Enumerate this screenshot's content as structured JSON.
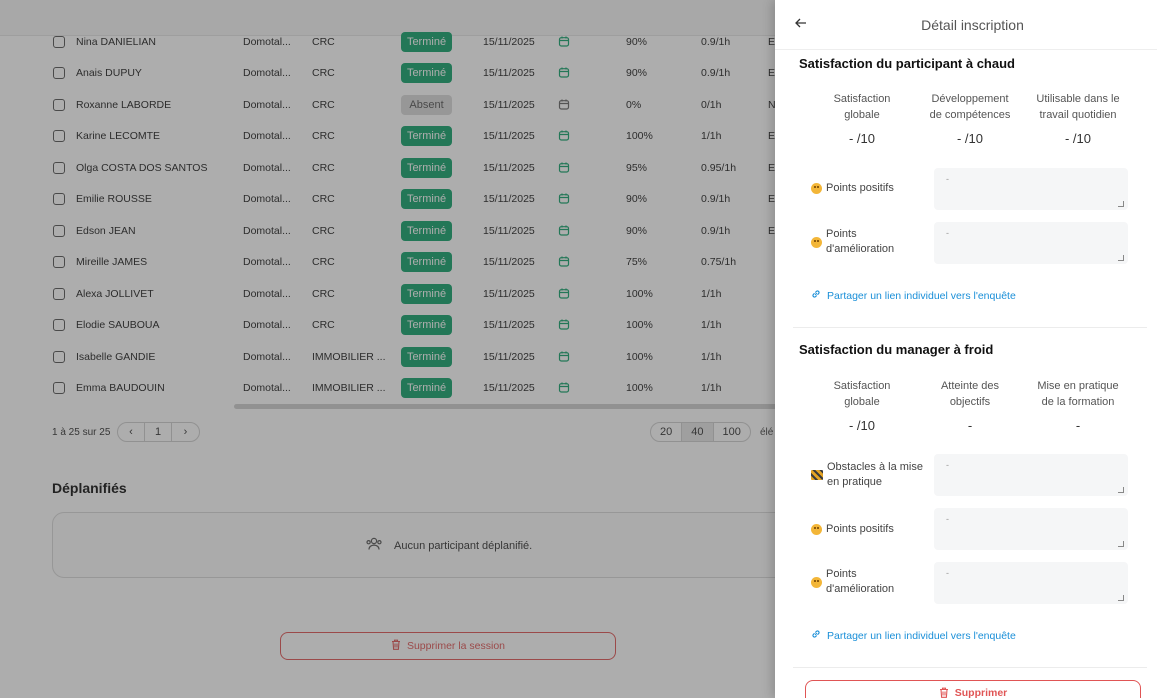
{
  "table": {
    "rows": [
      {
        "name": "Nina DANIELIAN",
        "domain": "Domotal...",
        "crc": "CRC",
        "status": "Terminé",
        "date": "15/11/2025",
        "pct": "90%",
        "ratio": "0.9/1h",
        "extra": "E"
      },
      {
        "name": "Anais DUPUY",
        "domain": "Domotal...",
        "crc": "CRC",
        "status": "Terminé",
        "date": "15/11/2025",
        "pct": "90%",
        "ratio": "0.9/1h",
        "extra": "E"
      },
      {
        "name": "Roxanne LABORDE",
        "domain": "Domotal...",
        "crc": "CRC",
        "status": "Absent",
        "date": "15/11/2025",
        "pct": "0%",
        "ratio": "0/1h",
        "extra": "N"
      },
      {
        "name": "Karine LECOMTE",
        "domain": "Domotal...",
        "crc": "CRC",
        "status": "Terminé",
        "date": "15/11/2025",
        "pct": "100%",
        "ratio": "1/1h",
        "extra": "E"
      },
      {
        "name": "Olga COSTA DOS SANTOS",
        "domain": "Domotal...",
        "crc": "CRC",
        "status": "Terminé",
        "date": "15/11/2025",
        "pct": "95%",
        "ratio": "0.95/1h",
        "extra": "E"
      },
      {
        "name": "Emilie ROUSSE",
        "domain": "Domotal...",
        "crc": "CRC",
        "status": "Terminé",
        "date": "15/11/2025",
        "pct": "90%",
        "ratio": "0.9/1h",
        "extra": "E"
      },
      {
        "name": "Edson JEAN",
        "domain": "Domotal...",
        "crc": "CRC",
        "status": "Terminé",
        "date": "15/11/2025",
        "pct": "90%",
        "ratio": "0.9/1h",
        "extra": "E"
      },
      {
        "name": "Mireille JAMES",
        "domain": "Domotal...",
        "crc": "CRC",
        "status": "Terminé",
        "date": "15/11/2025",
        "pct": "75%",
        "ratio": "0.75/1h",
        "extra": ""
      },
      {
        "name": "Alexa JOLLIVET",
        "domain": "Domotal...",
        "crc": "CRC",
        "status": "Terminé",
        "date": "15/11/2025",
        "pct": "100%",
        "ratio": "1/1h",
        "extra": ""
      },
      {
        "name": "Elodie SAUBOUA",
        "domain": "Domotal...",
        "crc": "CRC",
        "status": "Terminé",
        "date": "15/11/2025",
        "pct": "100%",
        "ratio": "1/1h",
        "extra": ""
      },
      {
        "name": "Isabelle GANDIE",
        "domain": "Domotal...",
        "crc": "IMMOBILIER ...",
        "status": "Terminé",
        "date": "15/11/2025",
        "pct": "100%",
        "ratio": "1/1h",
        "extra": ""
      },
      {
        "name": "Emma BAUDOUIN",
        "domain": "Domotal...",
        "crc": "IMMOBILIER ...",
        "status": "Terminé",
        "date": "15/11/2025",
        "pct": "100%",
        "ratio": "1/1h",
        "extra": ""
      }
    ],
    "pagination": {
      "summary": "1 à 25 sur 25",
      "prev": "‹",
      "page": "1",
      "next": "›"
    },
    "page_sizes": [
      "20",
      "40",
      "100"
    ],
    "page_sizes_label": "élé"
  },
  "deplanifies": {
    "title": "Déplanifiés",
    "empty_text": "Aucun participant déplanifié."
  },
  "delete_session_label": "Supprimer la session",
  "drawer": {
    "back": "←",
    "title": "Détail inscription",
    "hot": {
      "title": "Satisfaction du participant à chaud",
      "metrics": [
        {
          "label_line1": "Satisfaction",
          "label_line2": "globale",
          "value": "- /10"
        },
        {
          "label_line1": "Développement",
          "label_line2": "de compétences",
          "value": "- /10"
        },
        {
          "label_line1": "Utilisable dans le",
          "label_line2": "travail quotidien",
          "value": "- /10"
        }
      ],
      "positive_label": "Points positifs",
      "positive_value": "-",
      "improve_label_line1": "Points",
      "improve_label_line2": "d'amélioration",
      "improve_value": "-",
      "share_link": "Partager un lien individuel vers l'enquête"
    },
    "cold": {
      "title": "Satisfaction du manager à froid",
      "metrics": [
        {
          "label_line1": "Satisfaction",
          "label_line2": "globale",
          "value": "- /10"
        },
        {
          "label_line1": "Atteinte des",
          "label_line2": "objectifs",
          "value": "-"
        },
        {
          "label_line1": "Mise en pratique",
          "label_line2": "de la formation",
          "value": "-"
        }
      ],
      "obstacles_label_line1": "Obstacles à la mise",
      "obstacles_label_line2": "en pratique",
      "obstacles_value": "-",
      "positive_label": "Points positifs",
      "positive_value": "-",
      "improve_label_line1": "Points",
      "improve_label_line2": "d'amélioration",
      "improve_value": "-",
      "share_link": "Partager un lien individuel vers l'enquête"
    },
    "delete_label": "Supprimer"
  },
  "colors": {
    "accent_green": "#12a26b",
    "link_blue": "#1a8fd8",
    "danger_red": "#e05555"
  }
}
